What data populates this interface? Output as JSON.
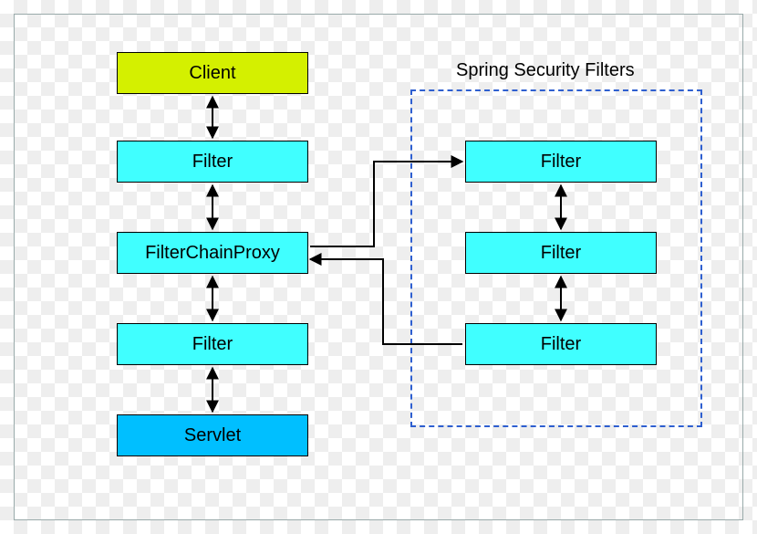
{
  "left_chain": {
    "client": "Client",
    "filter_top": "Filter",
    "proxy": "FilterChainProxy",
    "filter_bottom": "Filter",
    "servlet": "Servlet"
  },
  "security_group": {
    "title": "Spring Security Filters",
    "filter_1": "Filter",
    "filter_2": "Filter",
    "filter_3": "Filter"
  },
  "colors": {
    "client_bg": "#d4f000",
    "filter_bg": "#40ffff",
    "servlet_bg": "#00bfff",
    "dash_border": "#2e5fd0"
  }
}
